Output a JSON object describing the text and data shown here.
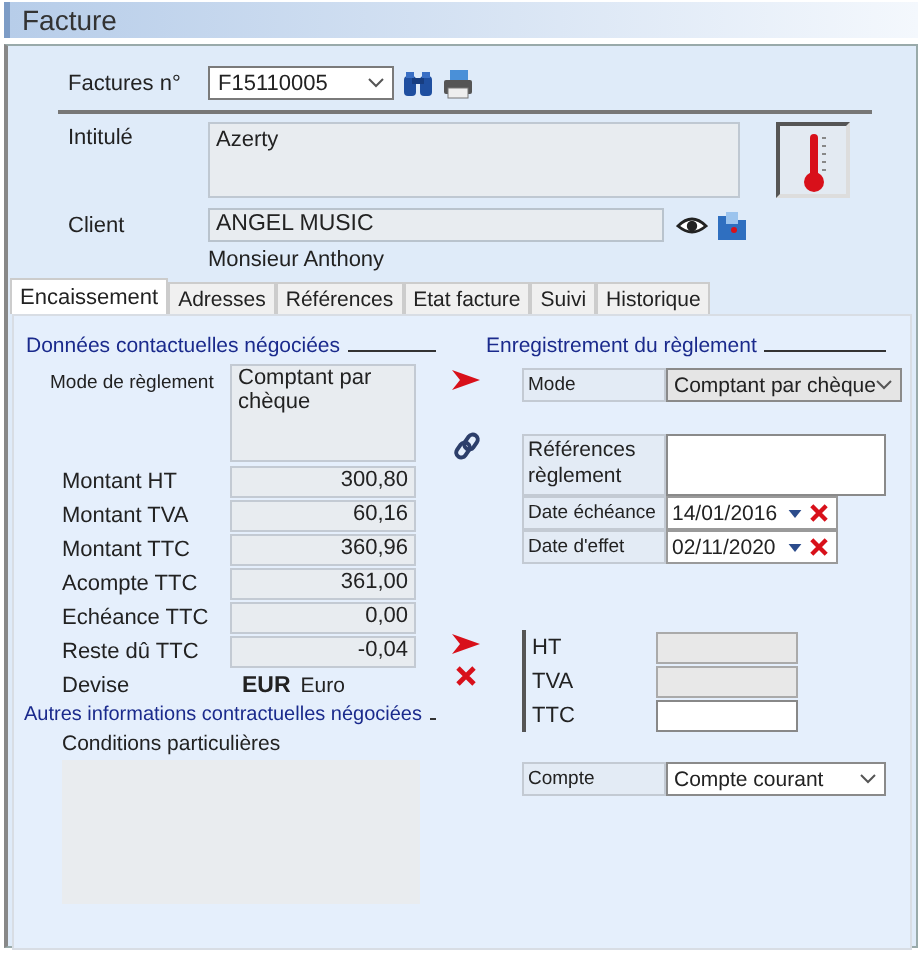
{
  "window": {
    "title": "Facture"
  },
  "header": {
    "invoice_label": "Factures n°",
    "invoice_number": "F15110005",
    "title_label": "Intitulé",
    "title_value": "Azerty",
    "client_label": "Client",
    "client_name": "ANGEL MUSIC",
    "contact": "Monsieur Anthony"
  },
  "tabs": [
    {
      "label": "Encaissement",
      "selected": true
    },
    {
      "label": "Adresses",
      "selected": false
    },
    {
      "label": "Références",
      "selected": false
    },
    {
      "label": "Etat facture",
      "selected": false
    },
    {
      "label": "Suivi",
      "selected": false
    },
    {
      "label": "Historique",
      "selected": false
    }
  ],
  "negotiated": {
    "heading": "Données contactuelles négociées",
    "mode_label": "Mode de règlement",
    "mode_value": "Comptant par chèque",
    "amounts": [
      {
        "label": "Montant HT",
        "value": "300,80"
      },
      {
        "label": "Montant TVA",
        "value": "60,16"
      },
      {
        "label": "Montant TTC",
        "value": "360,96"
      },
      {
        "label": "Acompte TTC",
        "value": "361,00"
      },
      {
        "label": "Echéance TTC",
        "value": "0,00"
      },
      {
        "label": "Reste dû TTC",
        "value": "-0,04"
      }
    ],
    "currency_label": "Devise",
    "currency_code": "EUR",
    "currency_name": "Euro"
  },
  "other": {
    "heading": "Autres informations contractuelles négociées",
    "conditions_label": "Conditions particulières"
  },
  "payment": {
    "heading": "Enregistrement du règlement",
    "mode_label": "Mode",
    "mode_value": "Comptant par chèque",
    "references_label": "Références règlement",
    "due_date_label": "Date échéance",
    "due_date": "14/01/2016",
    "effect_date_label": "Date d'effet",
    "effect_date": "02/11/2020",
    "split": [
      {
        "label": "HT",
        "disabled": true
      },
      {
        "label": "TVA",
        "disabled": true
      },
      {
        "label": "TTC",
        "disabled": false
      }
    ],
    "account_label": "Compte",
    "account_value": "Compte courant"
  }
}
